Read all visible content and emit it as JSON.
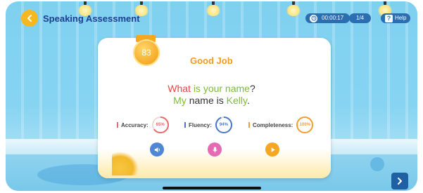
{
  "header": {
    "title": "Speaking Assessment",
    "timer": "00:00:17",
    "progress": "1/4",
    "help_label": "Help",
    "help_glyph": "?"
  },
  "card": {
    "score": "83",
    "headline": "Good Job",
    "question": {
      "part1": "What",
      "part2": "is your name",
      "part3": "?"
    },
    "answer": {
      "part1": "My",
      "part2": "name is",
      "part3": "Kelly",
      "part4": "."
    }
  },
  "metrics": [
    {
      "label": "Accuracy:",
      "value": "65%",
      "percent": 65,
      "color": "#e86a6a"
    },
    {
      "label": "Fluency:",
      "value": "94%",
      "percent": 94,
      "color": "#4a78c9"
    },
    {
      "label": "Completeness:",
      "value": "100%",
      "percent": 100,
      "color": "#f0a030"
    }
  ],
  "controls": {
    "speaker_color": "#4f86d6",
    "mic_color": "#e669b3",
    "play_color": "#f5a623"
  },
  "icons": {
    "back": "back-chevron-icon",
    "clock": "clock-icon",
    "help": "help-icon",
    "speaker": "speaker-icon",
    "mic": "microphone-icon",
    "play": "play-icon",
    "next": "chevron-right-icon"
  }
}
